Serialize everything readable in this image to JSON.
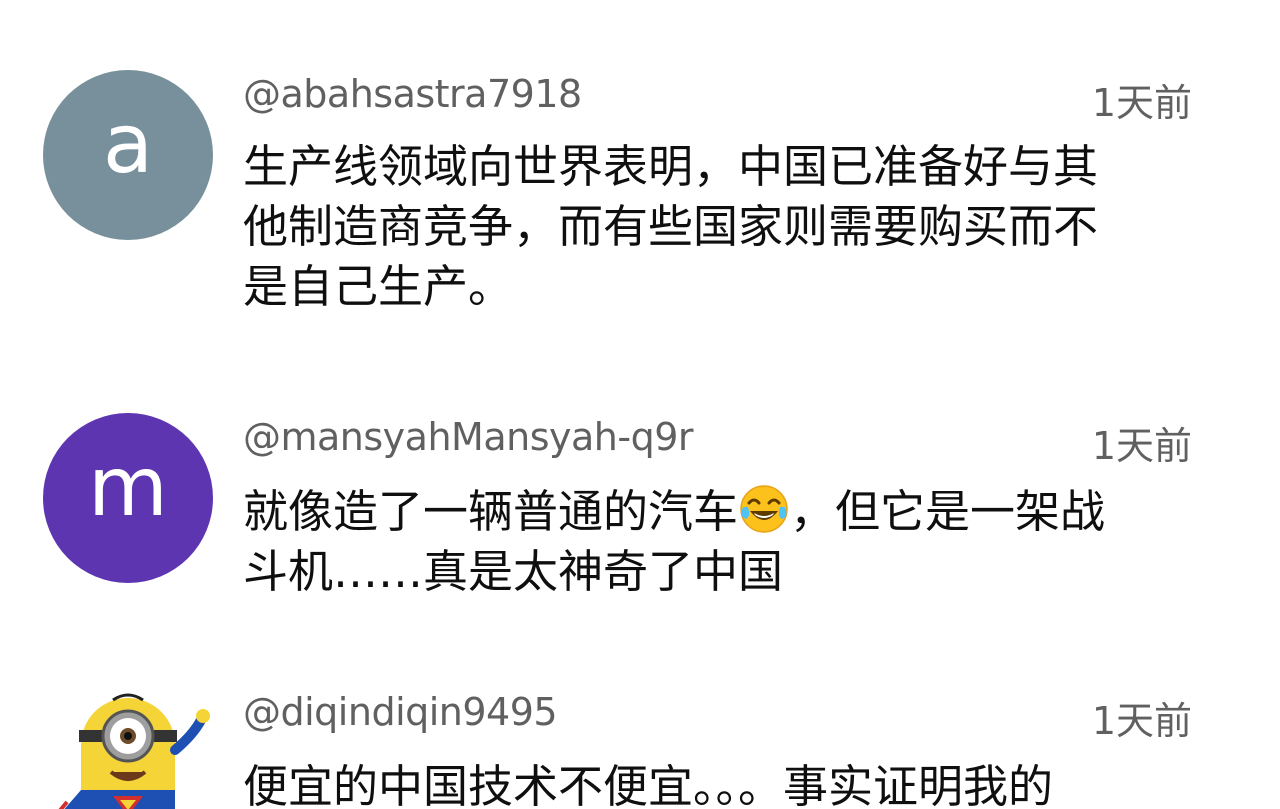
{
  "comments": [
    {
      "avatar_letter": "a",
      "avatar_color": "#78909c",
      "handle": "@abahsastra7918",
      "time": "1天前",
      "text": "生产线领域向世界表明，中国已准备好与其\n他制造商竞争，而有些国家则需要购买而不\n是自己生产。"
    },
    {
      "avatar_letter": "m",
      "avatar_color": "#5e35b1",
      "handle": "@mansyahMansyah-q9r",
      "time": "1天前",
      "text_before_emoji": "就像造了一辆普通的汽车",
      "emoji": "face-with-tears-of-joy",
      "text_after_emoji": "，但它是一架战\n斗机……真是太神奇了中国"
    },
    {
      "avatar_image": "minion-superman-avatar",
      "handle": "@diqindiqin9495",
      "time": "1天前",
      "text": "便宜的中国技术不便宜。。。事实证明我的"
    }
  ]
}
